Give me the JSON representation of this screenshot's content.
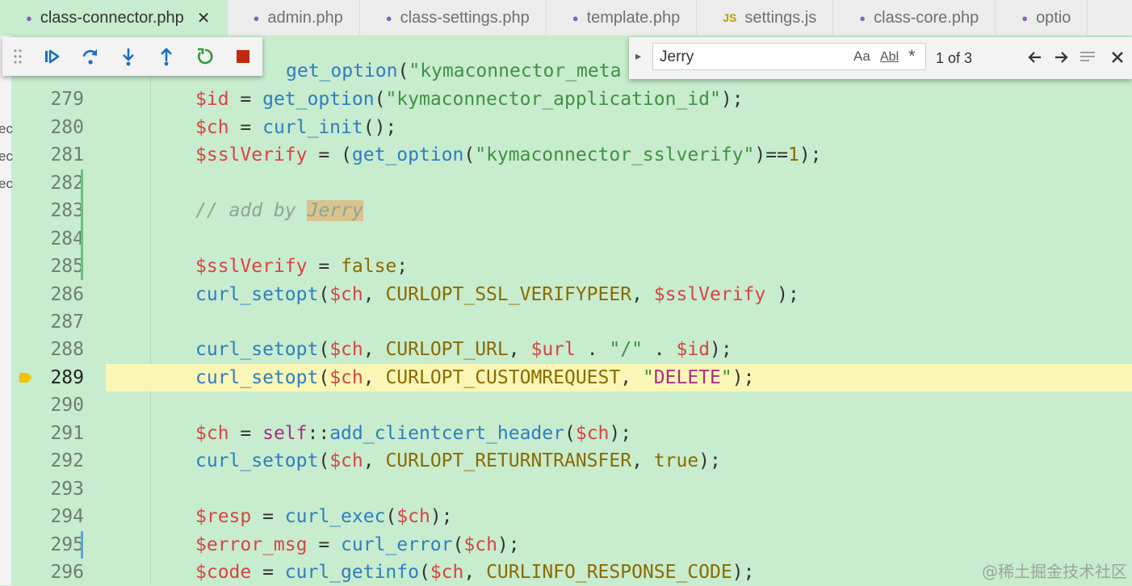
{
  "tabs": [
    {
      "label": "class-connector.php",
      "icon": "php-icon",
      "active": true,
      "close": "✕"
    },
    {
      "label": "admin.php",
      "icon": "php-icon"
    },
    {
      "label": "class-settings.php",
      "icon": "php-icon"
    },
    {
      "label": "template.php",
      "icon": "php-icon"
    },
    {
      "label": "settings.js",
      "icon": "js-icon",
      "icon_text": "JS"
    },
    {
      "label": "class-core.php",
      "icon": "php-icon"
    },
    {
      "label": "optio",
      "icon": "php-icon"
    }
  ],
  "left_strip": [
    "ec",
    "ec",
    "ec"
  ],
  "debug_toolbar": {
    "buttons": [
      "drag-grip",
      "continue",
      "step-over",
      "step-into",
      "step-out",
      "restart",
      "stop"
    ]
  },
  "find_widget": {
    "value": "Jerry",
    "match_case": "Aa",
    "whole_word": "Abl",
    "regex": "*",
    "count": "1 of 3"
  },
  "editor": {
    "current_line": 289,
    "top_partial_code": "get_option(\"kymaconnector_meta",
    "lines": [
      {
        "num": "279",
        "code": "$id = get_option(\"kymaconnector_application_id\");"
      },
      {
        "num": "280",
        "code": "$ch = curl_init();"
      },
      {
        "num": "281",
        "code": "$sslVerify = (get_option(\"kymaconnector_sslverify\")==1);"
      },
      {
        "num": "282",
        "code": ""
      },
      {
        "num": "283",
        "code": "// add by Jerry"
      },
      {
        "num": "284",
        "code": ""
      },
      {
        "num": "285",
        "code": "$sslVerify = false;"
      },
      {
        "num": "286",
        "code": "curl_setopt($ch, CURLOPT_SSL_VERIFYPEER, $sslVerify );"
      },
      {
        "num": "287",
        "code": ""
      },
      {
        "num": "288",
        "code": "curl_setopt($ch, CURLOPT_URL, $url . \"/\" . $id);"
      },
      {
        "num": "289",
        "code": "curl_setopt($ch, CURLOPT_CUSTOMREQUEST, \"DELETE\");"
      },
      {
        "num": "290",
        "code": ""
      },
      {
        "num": "291",
        "code": "$ch = self::add_clientcert_header($ch);"
      },
      {
        "num": "292",
        "code": "curl_setopt($ch, CURLOPT_RETURNTRANSFER, true);"
      },
      {
        "num": "293",
        "code": ""
      },
      {
        "num": "294",
        "code": "$resp = curl_exec($ch);"
      },
      {
        "num": "295",
        "code": "$error_msg = curl_error($ch);"
      },
      {
        "num": "296",
        "code": "$code = curl_getinfo($ch, CURLINFO_RESPONSE_CODE);"
      }
    ]
  },
  "colors": {
    "editor_bg": "#c8ecce",
    "current_line_bg": "#faf6b5",
    "variable": "#d64444",
    "function": "#2f7dc0",
    "string": "#3f9144",
    "comment": "#8fa596",
    "keyword": "#a8307e",
    "constant": "#8b6a00",
    "search_highlight": "#d9c38f",
    "gutter_added": "#6cbf7c",
    "gutter_modified": "#5aa6e0"
  },
  "watermark": "@稀土掘金技术社区"
}
